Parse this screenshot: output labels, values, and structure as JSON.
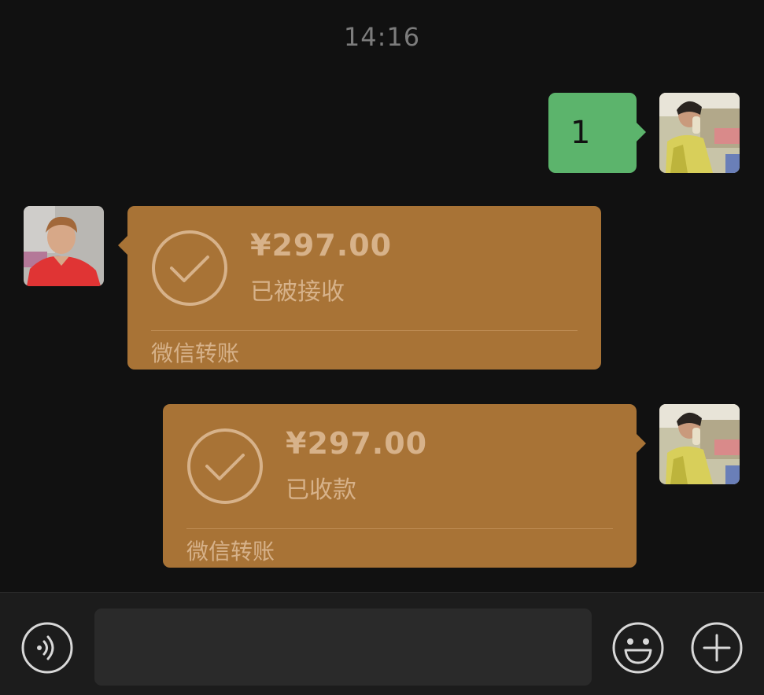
{
  "chat": {
    "timestamp": "14:16",
    "messages": [
      {
        "sender": "me",
        "type": "text",
        "text": "1"
      },
      {
        "sender": "other",
        "type": "transfer",
        "amount": "¥297.00",
        "status": "已被接收",
        "label": "微信转账"
      },
      {
        "sender": "me",
        "type": "transfer",
        "amount": "¥297.00",
        "status": "已收款",
        "label": "微信转账"
      }
    ]
  },
  "input_bar": {
    "voice_icon": "voice-icon",
    "emoji_icon": "emoji-icon",
    "plus_icon": "plus-icon",
    "input_value": ""
  },
  "colors": {
    "background": "#111111",
    "text_bubble": "#5cb46c",
    "transfer_bubble": "#a87336",
    "transfer_text": "#d7b28a"
  }
}
